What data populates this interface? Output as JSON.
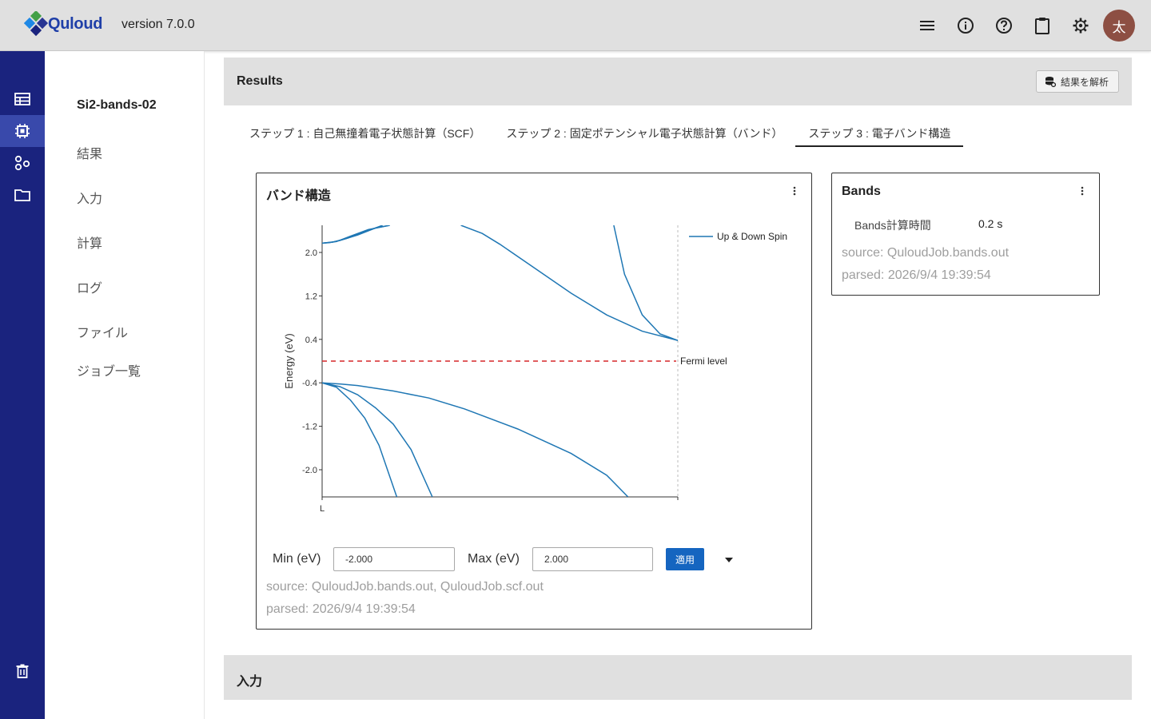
{
  "app": {
    "brand": "Quloud",
    "version": "version 7.0.0",
    "avatar_initial": "太",
    "header_icons": [
      "menu-icon",
      "info-icon",
      "help-icon",
      "clipboard-icon",
      "settings-icon"
    ]
  },
  "rail": {
    "items": [
      "dashboard-icon",
      "chip-icon",
      "apps-icon",
      "folder-icon"
    ],
    "active": "chip-icon",
    "bottom": "trash-icon"
  },
  "subnav": {
    "job_title": "Si2-bands-02",
    "items": [
      "結果",
      "入力",
      "計算",
      "ログ",
      "ファイル",
      "ジョブ一覧"
    ]
  },
  "results": {
    "title": "Results",
    "analyze_label": "結果を解析"
  },
  "tabs": [
    {
      "label": "ステップ 1 : 自己無撞着電子状態計算（SCF）"
    },
    {
      "label": "ステップ 2 : 固定ポテンシャル電子状態計算（バンド）"
    },
    {
      "label": "ステップ 3 : 電子バンド構造",
      "active": true
    }
  ],
  "band_card": {
    "title": "バンド構造",
    "min_label": "Min (eV)",
    "min_value": "-2.000",
    "max_label": "Max (eV)",
    "max_value": "2.000",
    "apply_label": "適用",
    "source": "source: QuloudJob.bands.out, QuloudJob.scf.out",
    "parsed": "parsed: 2026/9/4 19:39:54"
  },
  "bands_card": {
    "title": "Bands",
    "key": "Bands計算時間",
    "value": "0.2 s",
    "source": "source: QuloudJob.bands.out",
    "parsed": "parsed: 2026/9/4 19:39:54"
  },
  "input_section": {
    "title": "入力"
  },
  "chart_data": {
    "type": "line",
    "ylabel": "Energy (eV)",
    "ylim": [
      -2.5,
      2.5
    ],
    "yticks": [
      -2.0,
      -1.2,
      -0.4,
      0.4,
      1.2,
      2.0
    ],
    "ytick_labels": [
      "-2.0",
      "-1.2",
      "-0.4",
      "0.4",
      "1.2",
      "2.0"
    ],
    "xlim": [
      0,
      1
    ],
    "xtick_labels": [
      "L"
    ],
    "fermi_level": 0.0,
    "fermi_label": "Fermi level",
    "legend": "Up & Down Spin",
    "legend_position": "top-right",
    "line_color": "#1f77b4",
    "fermi_color": "#d62728",
    "series": [
      {
        "x": [
          0,
          0.02,
          0.05,
          0.1,
          0.15,
          0.19
        ],
        "y": [
          2.17,
          2.18,
          2.22,
          2.32,
          2.45,
          2.5
        ]
      },
      {
        "x": [
          0,
          0.03,
          0.07,
          0.12,
          0.17
        ],
        "y": [
          2.17,
          2.19,
          2.26,
          2.38,
          2.5
        ]
      },
      {
        "x": [
          0,
          0.04,
          0.08,
          0.13,
          0.19
        ],
        "y": [
          2.17,
          2.2,
          2.3,
          2.42,
          2.5
        ]
      },
      {
        "x": [
          0.39,
          0.45,
          0.5,
          0.6,
          0.7,
          0.8,
          0.9,
          1.0
        ],
        "y": [
          2.5,
          2.35,
          2.15,
          1.7,
          1.25,
          0.85,
          0.55,
          0.38
        ]
      },
      {
        "x": [
          0.82,
          0.85,
          0.9,
          0.95,
          1.0
        ],
        "y": [
          2.5,
          1.6,
          0.85,
          0.5,
          0.38
        ]
      },
      {
        "x": [
          0,
          0.05,
          0.1,
          0.2,
          0.3,
          0.4,
          0.55,
          0.7,
          0.8,
          0.86
        ],
        "y": [
          -0.4,
          -0.42,
          -0.45,
          -0.55,
          -0.68,
          -0.88,
          -1.25,
          -1.7,
          -2.1,
          -2.5
        ]
      },
      {
        "x": [
          0,
          0.05,
          0.1,
          0.15,
          0.2,
          0.25,
          0.31
        ],
        "y": [
          -0.4,
          -0.47,
          -0.62,
          -0.86,
          -1.16,
          -1.63,
          -2.5
        ]
      },
      {
        "x": [
          0,
          0.04,
          0.08,
          0.12,
          0.16,
          0.21
        ],
        "y": [
          -0.4,
          -0.48,
          -0.72,
          -1.05,
          -1.55,
          -2.5
        ]
      }
    ]
  }
}
